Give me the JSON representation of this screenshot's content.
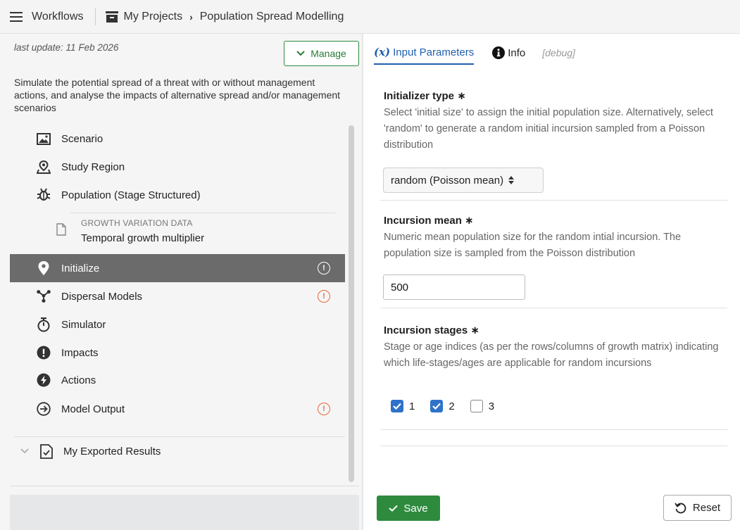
{
  "topbar": {
    "workflows_label": "Workflows",
    "breadcrumb": [
      "My Projects",
      "Population Spread Modelling"
    ]
  },
  "left": {
    "last_update": "last update: 11 Feb 2026",
    "manage_label": "Manage",
    "description": "Simulate the potential spread of a threat with or without management actions, and analyse the impacts of alternative spread and/or management scenarios",
    "items": [
      {
        "label": "Scenario",
        "icon": "image-icon"
      },
      {
        "label": "Study Region",
        "icon": "map-pin-region-icon"
      },
      {
        "label": "Population (Stage Structured)",
        "icon": "bug-icon"
      },
      {
        "label": "Initialize",
        "icon": "map-marker-icon",
        "active": true,
        "warning": true
      },
      {
        "label": "Dispersal Models",
        "icon": "dispersal-network-icon",
        "warning": true
      },
      {
        "label": "Simulator",
        "icon": "stopwatch-icon"
      },
      {
        "label": "Impacts",
        "icon": "exclamation-circle-icon"
      },
      {
        "label": "Actions",
        "icon": "bolt-circle-icon"
      },
      {
        "label": "Model Output",
        "icon": "arrow-circle-right-icon",
        "warning": true
      }
    ],
    "sub_item": {
      "caption": "GROWTH VARIATION DATA",
      "label": "Temporal growth multiplier"
    },
    "exported_label": "My Exported Results"
  },
  "tabs": {
    "input_params_symbol": "(x)",
    "input_params": "Input Parameters",
    "info": "Info",
    "debug": "[debug]"
  },
  "form": {
    "initializer": {
      "title": "Initializer type ∗",
      "desc": "Select 'initial size' to assign the initial population size. Alternatively, select 'random' to generate a random initial incursion sampled from a Poisson distribution",
      "selected": "random (Poisson mean)"
    },
    "mean": {
      "title": "Incursion mean ∗",
      "desc": "Numeric mean population size for the random intial incursion. The population size is sampled from the Poisson distribution",
      "value": "500"
    },
    "stages": {
      "title": "Incursion stages ∗",
      "desc": "Stage or age indices (as per the rows/columns of growth matrix) indicating which life-stages/ages are applicable for random incursions",
      "options": [
        {
          "label": "1",
          "checked": true
        },
        {
          "label": "2",
          "checked": true
        },
        {
          "label": "3",
          "checked": false
        }
      ]
    }
  },
  "buttons": {
    "save": "Save",
    "reset": "Reset"
  },
  "colors": {
    "accent_green": "#2e8b3e",
    "tab_blue": "#1f5fae",
    "warning_orange": "#e8673a",
    "active_row": "#6b6b6b",
    "check_blue": "#2f72c9"
  }
}
